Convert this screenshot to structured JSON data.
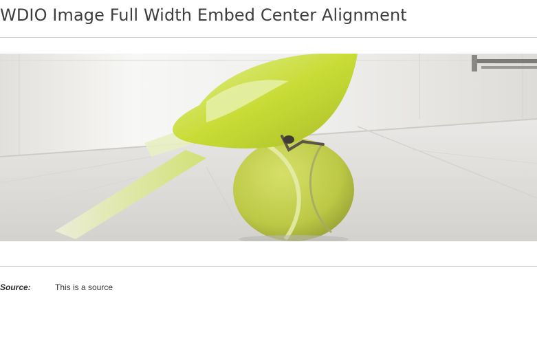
{
  "page": {
    "title": "WDIO Image Full Width Embed Center Alignment"
  },
  "image": {
    "alt": "Yellow-green parakeet standing on a tennis ball on a tiled floor"
  },
  "caption": {
    "source_label": "Source:",
    "source_text": "This is a source"
  },
  "colors": {
    "rule": "#cfcfcf",
    "title": "#3d3d3d",
    "bird": "#c7dc3a",
    "ball": "#c2cf49"
  }
}
